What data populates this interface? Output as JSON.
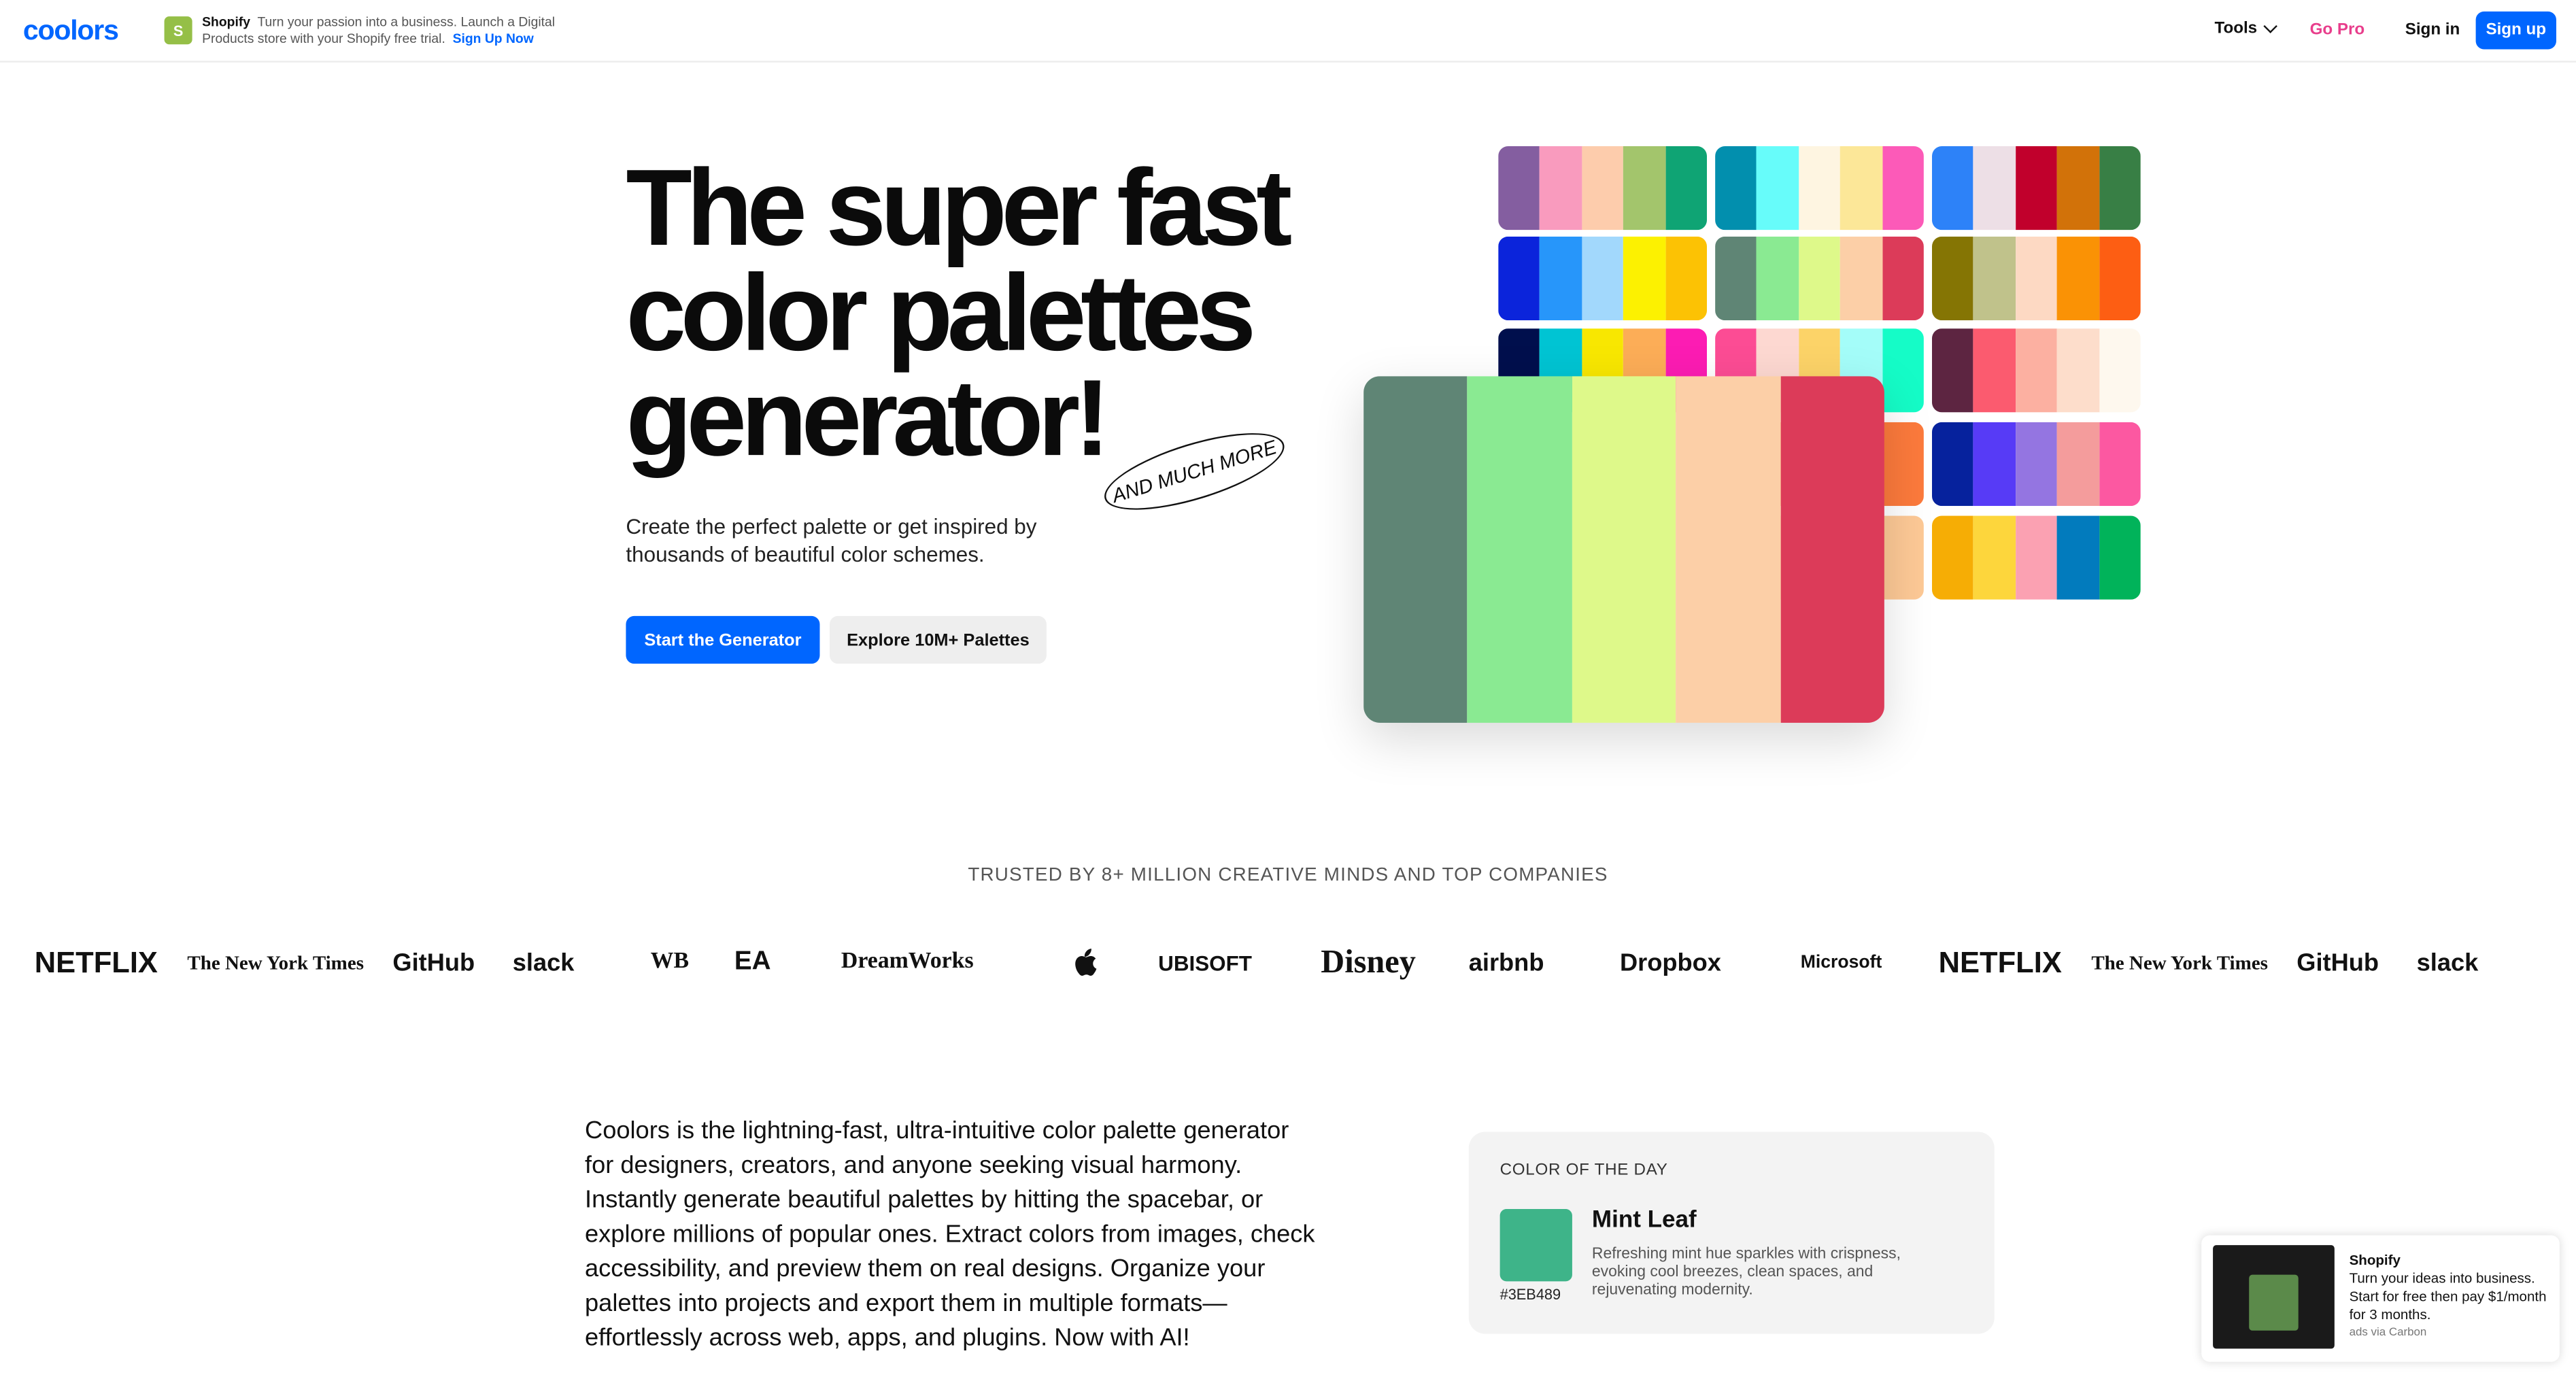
{
  "header": {
    "logo": "coolors",
    "ad": {
      "brand": "Shopify",
      "text": "Turn your passion into a business. Launch a Digital Products store with your Shopify free trial.",
      "cta": "Sign Up Now"
    },
    "nav": {
      "tools": "Tools",
      "go_pro": "Go Pro",
      "sign_in": "Sign in",
      "sign_up": "Sign up"
    }
  },
  "hero": {
    "title_line1": "The super fast",
    "title_line2": "color palettes",
    "title_line3": "generator!",
    "tag": "AND MUCH MORE",
    "subtitle": "Create the perfect palette or get inspired by thousands of beautiful color schemes.",
    "primary_button": "Start the Generator",
    "secondary_button": "Explore 10M+ Palettes"
  },
  "palettes": [
    [
      "#845EA0",
      "#F99BBE",
      "#FDCCAC",
      "#A3C56C",
      "#0FA474"
    ],
    [
      "#028FAE",
      "#67FCFA",
      "#FEF5E1",
      "#FCE798",
      "#FC5AB8"
    ],
    [
      "#2D82F8",
      "#EDDFE6",
      "#C1002C",
      "#D27209",
      "#387F45"
    ],
    [
      "#0B24DB",
      "#2796FA",
      "#A2D8FC",
      "#FCF101",
      "#FCC204"
    ],
    [
      "#5F8575",
      "#8AEA92",
      "#DEF98A",
      "#FCCFA7",
      "#DC3B59"
    ],
    [
      "#857504",
      "#C0C28B",
      "#FDD9C3",
      "#FA9205",
      "#FD5E13"
    ],
    [
      "#000F4D",
      "#00C4D3",
      "#F8E701",
      "#FCAD57",
      "#FC1CB3"
    ],
    [
      "#FC4C94",
      "#FDD8D1",
      "#FCD368",
      "#A4FDF9",
      "#15FCC7"
    ],
    [
      "#5D2541",
      "#FB5B6F",
      "#FCB0A1",
      "#FDDDCB",
      "#FEF8EE"
    ],
    [
      "#B5FC9B",
      "#FC7A3C",
      "#FC7A3C",
      "#FC7A3C",
      "#FC7A3C"
    ],
    [
      "#FDC996",
      "#FDC996",
      "#FDC996",
      "#FDC996",
      "#FDC996"
    ],
    [
      "#06229D",
      "#573BF6",
      "#9475E1",
      "#F49C9C",
      "#FC58A1"
    ],
    [
      "#F6AD05",
      "#FDD63C",
      "#FBA1B2",
      "#027BBD",
      "#01B35A"
    ]
  ],
  "featured_palette": [
    "#5F8575",
    "#8AEA92",
    "#DEF98A",
    "#FCCFA7",
    "#DC3B59"
  ],
  "trusted": {
    "heading": "TRUSTED BY 8+ MILLION CREATIVE MINDS AND TOP COMPANIES",
    "logos": [
      "NETFLIX",
      "The New York Times",
      "GitHub",
      "slack",
      "WB",
      "EA",
      "DreamWorks",
      "",
      "UBISOFT",
      "Disney",
      "airbnb",
      "Dropbox",
      "Microsoft",
      "NETFLIX",
      "The New York Times",
      "GitHub",
      "slack"
    ]
  },
  "about": {
    "text": "Coolors is the lightning-fast, ultra-intuitive color palette generator for designers, creators, and anyone seeking visual harmony. Instantly generate beautiful palettes by hitting the spacebar, or explore millions of popular ones. Extract colors from images, check accessibility, and preview them on real designs. Organize your palettes into projects and export them in multiple formats—effortlessly across web, apps, and plugins. Now with AI!"
  },
  "color_of_the_day": {
    "heading": "COLOR OF THE DAY",
    "name": "Mint Leaf",
    "hex": "#3EB489",
    "description": "Refreshing mint hue sparkles with crispness, evoking cool breezes, clean spaces, and rejuvenating modernity."
  },
  "carbon_ad": {
    "brand": "Shopify",
    "text": "Turn your ideas into business. Start for free then pay $1/month for 3 months.",
    "via": "ads via Carbon"
  }
}
